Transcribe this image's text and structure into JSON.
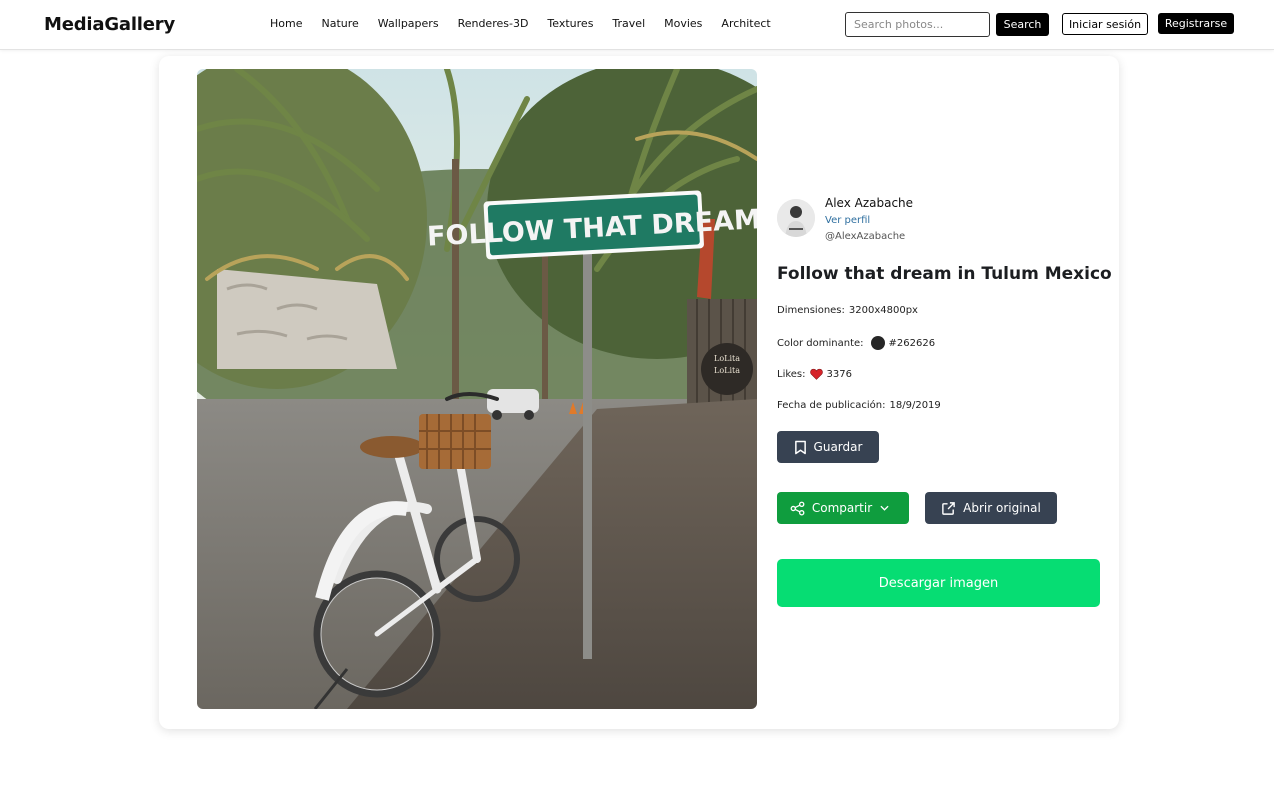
{
  "header": {
    "brand": "MediaGallery",
    "nav": [
      "Home",
      "Nature",
      "Wallpapers",
      "Renderes-3D",
      "Textures",
      "Travel",
      "Movies",
      "Architect"
    ],
    "search_placeholder": "Search photos...",
    "search_button": "Search",
    "login_button": "Iniciar sesión",
    "register_button": "Registrarse"
  },
  "photo": {
    "sign_text": "FOLLOW THAT DREAM",
    "sign_text_small": "LoLita"
  },
  "author": {
    "name": "Alex Azabache",
    "profile_link": "Ver perfil",
    "handle": "@AlexAzabache"
  },
  "details": {
    "title": "Follow that dream in Tulum Mexico",
    "dimensions_label": "Dimensiones:",
    "dimensions_value": "3200x4800px",
    "color_label": "Color dominante:",
    "color_value": "#262626",
    "likes_label": "Likes:",
    "likes_value": "3376",
    "date_label": "Fecha de publicación:",
    "date_value": "18/9/2019"
  },
  "actions": {
    "save": "Guardar",
    "share": "Compartir",
    "open": "Abrir original",
    "download": "Descargar imagen"
  },
  "icons": {
    "save": "bookmark-icon",
    "share": "share-icon",
    "dropdown": "chevron-down-icon",
    "open": "external-link-icon",
    "likes": "heart-icon"
  },
  "colors": {
    "save_button": "#374252",
    "share_button": "#0f9d3e",
    "download_button": "#06dd73",
    "dominant": "#262626",
    "heart": "#d6242a"
  }
}
